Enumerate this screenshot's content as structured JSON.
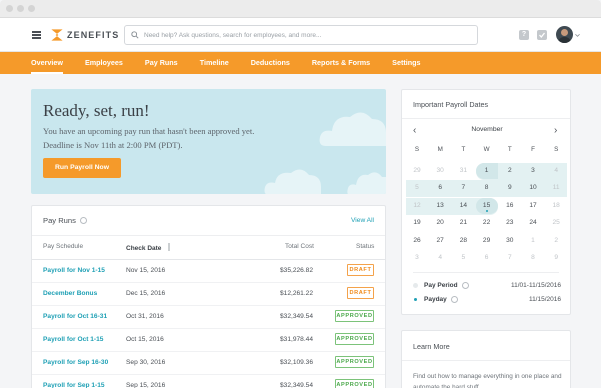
{
  "brand": {
    "name": "ZENEFITS",
    "accent": "#f59a2a",
    "link": "#1fa0b5"
  },
  "search": {
    "placeholder": "Need help? Ask questions, search for employees, and more..."
  },
  "topbar_icons": [
    "help-icon",
    "tasks-check-icon",
    "user-avatar",
    "chevron-down-icon"
  ],
  "topbar_help_glyph": "?",
  "nav": {
    "items": [
      "Overview",
      "Employees",
      "Pay Runs",
      "Timeline",
      "Deductions",
      "Reports & Forms",
      "Settings"
    ],
    "active": "Overview"
  },
  "hero": {
    "title": "Ready, set, run!",
    "line1": "You have an upcoming pay run that hasn't been approved yet.",
    "line2": "Deadline is Nov 11th at 2:00 PM (PDT).",
    "button": "Run Payroll Now"
  },
  "payruns": {
    "title": "Pay Runs",
    "view_all": "View All",
    "columns": [
      "Pay Schedule",
      "Check Date",
      "Total Cost",
      "Status"
    ],
    "rows": [
      {
        "schedule": "Payroll for Nov 1-15",
        "date": "Nov 15, 2016",
        "cost": "$35,226.82",
        "status": "DRAFT"
      },
      {
        "schedule": "December Bonus",
        "date": "Dec 15, 2016",
        "cost": "$12,261.22",
        "status": "DRAFT"
      },
      {
        "schedule": "Payroll for Oct 16-31",
        "date": "Oct 31, 2016",
        "cost": "$32,349.54",
        "status": "APPROVED"
      },
      {
        "schedule": "Payroll for Oct 1-15",
        "date": "Oct 15, 2016",
        "cost": "$31,978.44",
        "status": "APPROVED"
      },
      {
        "schedule": "Payroll for Sep 16-30",
        "date": "Sep 30, 2016",
        "cost": "$32,109.36",
        "status": "APPROVED"
      },
      {
        "schedule": "Payroll for Sep 1-15",
        "date": "Sep 15, 2016",
        "cost": "$32,349.54",
        "status": "APPROVED"
      }
    ]
  },
  "dates": {
    "title": "Important Payroll Dates",
    "month": "November",
    "dow": [
      "S",
      "M",
      "T",
      "W",
      "T",
      "F",
      "S"
    ],
    "weeks": [
      [
        "29",
        "30",
        "31",
        "1",
        "2",
        "3",
        "4"
      ],
      [
        "5",
        "6",
        "7",
        "8",
        "9",
        "10",
        "11"
      ],
      [
        "12",
        "13",
        "14",
        "15",
        "16",
        "17",
        "18"
      ],
      [
        "19",
        "20",
        "21",
        "22",
        "23",
        "24",
        "25"
      ],
      [
        "26",
        "27",
        "28",
        "29",
        "30",
        "1",
        "2"
      ],
      [
        "3",
        "4",
        "5",
        "6",
        "7",
        "8",
        "9"
      ]
    ],
    "muted_weeks": {
      "0": [
        0,
        1,
        2,
        6
      ],
      "1": [
        0,
        6
      ],
      "2": [
        0,
        6
      ],
      "3": [
        6
      ],
      "4": [
        5,
        6
      ],
      "5": [
        0,
        1,
        2,
        3,
        4,
        5,
        6
      ]
    },
    "today_week": 2,
    "today_day": 3,
    "range_start_week": 0,
    "range_start_day": 3,
    "pay_period_label": "Pay Period",
    "pay_period_value": "11/01-11/15/2016",
    "payday_label": "Payday",
    "payday_value": "11/15/2016"
  },
  "learn": {
    "title": "Learn More",
    "text": "Find out how to manage everything in one place and automate the hard stuff."
  }
}
